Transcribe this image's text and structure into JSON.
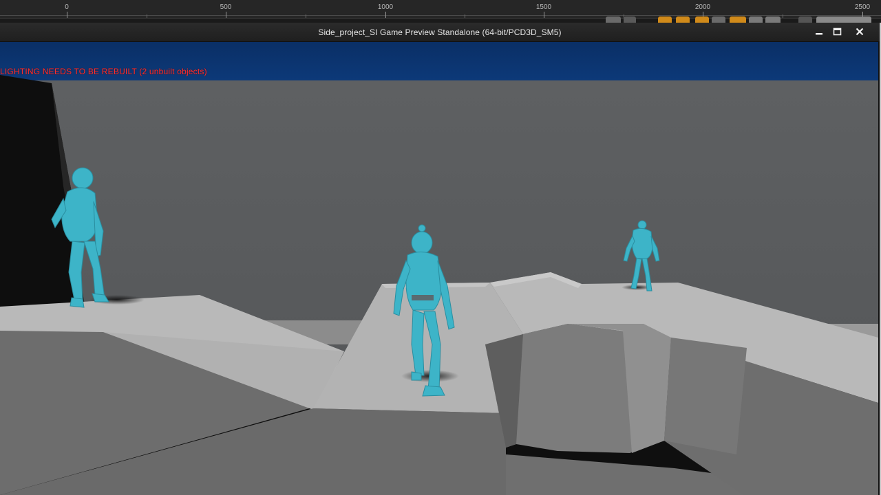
{
  "editor": {
    "ruler": {
      "labels": [
        "0",
        "500",
        "1000",
        "1500",
        "2000",
        "2500"
      ]
    }
  },
  "game_window": {
    "title": "Side_project_SI Game Preview Standalone (64-bit/PCD3D_SM5)",
    "controls": {
      "minimize_icon": "minimize-icon",
      "maximize_icon": "maximize-icon",
      "close_icon": "close-icon"
    },
    "viewport": {
      "warning": "LIGHTING NEEDS TO BE REBUILT (2 unbuilt objects)",
      "colors": {
        "sky": "#0d3a7a",
        "backdrop": "#5c5e60",
        "floor_top": "#b8b8b8",
        "character": "#3db4c8",
        "warning_text": "#ff3030"
      },
      "characters": [
        "left-mannequin",
        "center-mannequin",
        "right-mannequin"
      ]
    }
  }
}
